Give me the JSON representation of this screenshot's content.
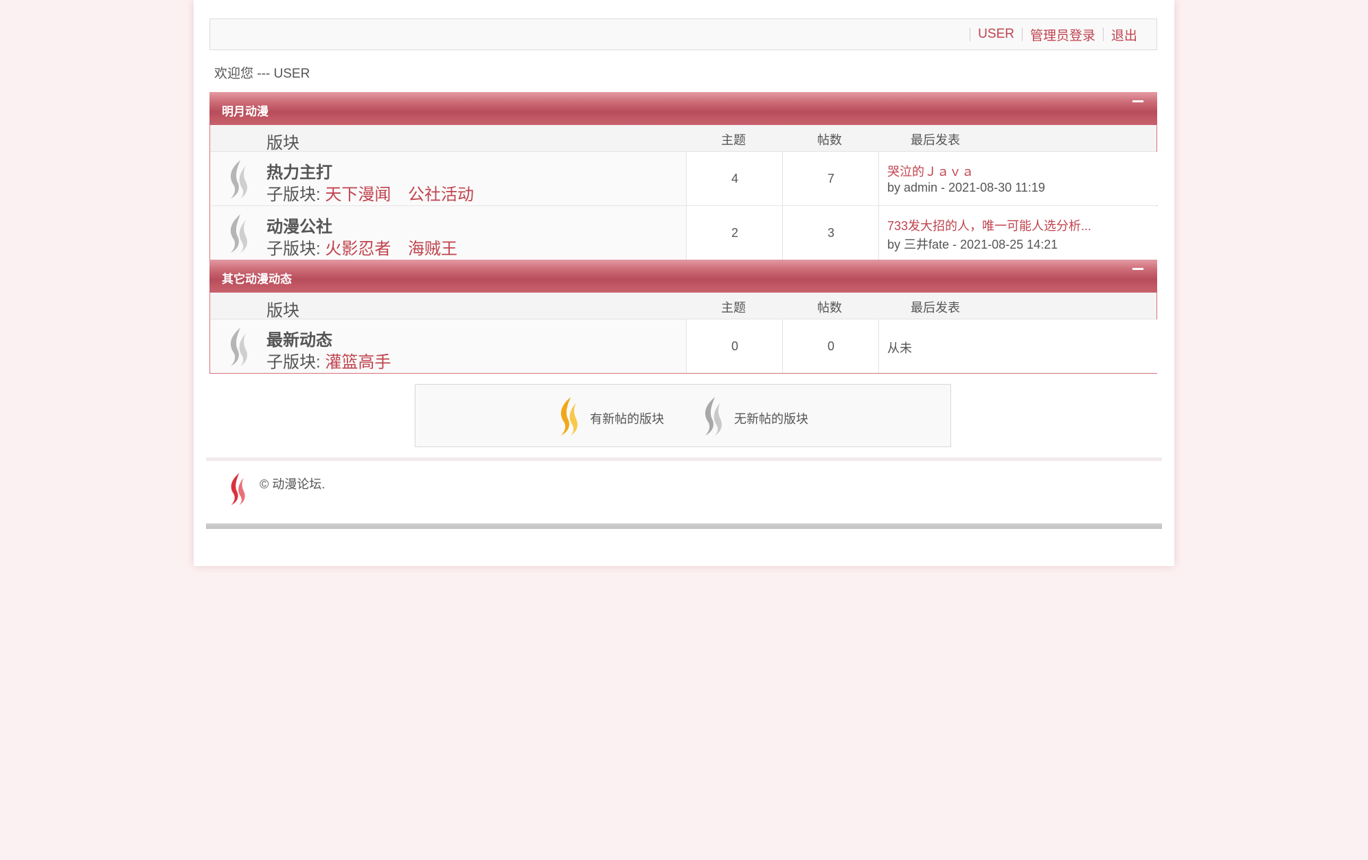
{
  "topbar": {
    "user_link": "USER",
    "admin_login": "管理员登录",
    "logout": "退出"
  },
  "welcome": "欢迎您 --- USER",
  "columns": {
    "forum": "版块",
    "topics": "主题",
    "posts": "帖数",
    "last_post": "最后发表"
  },
  "sub_prefix": "子版块:",
  "categories": [
    {
      "title": "明月动漫",
      "forums": [
        {
          "name": "热力主打",
          "subforums": [
            "天下漫闻",
            "公社活动"
          ],
          "topics": "4",
          "posts": "7",
          "last_title": "哭泣的Ｊａｖａ",
          "last_by": "by admin - 2021-08-30 11:19"
        },
        {
          "name": "动漫公社",
          "subforums": [
            "火影忍者",
            "海贼王"
          ],
          "topics": "2",
          "posts": "3",
          "last_title": "733发大招的人，唯一可能人选分析...",
          "last_by": "by 三井fate - 2021-08-25 14:21"
        }
      ]
    },
    {
      "title": "其它动漫动态",
      "forums": [
        {
          "name": "最新动态",
          "subforums": [
            "灌篮高手"
          ],
          "topics": "0",
          "posts": "0",
          "last_never": "从未"
        }
      ]
    }
  ],
  "legend": {
    "new_label": "有新帖的版块",
    "none_label": "无新帖的版块"
  },
  "footer": {
    "copyright": "© 动漫论坛."
  },
  "colors": {
    "accent": "#c0444f",
    "header": "#b84d5a",
    "background": "#fcf1f2",
    "flame_new": "#f0a81a",
    "flame_none": "#a8a8a8",
    "flame_logo": "#d8323f"
  }
}
